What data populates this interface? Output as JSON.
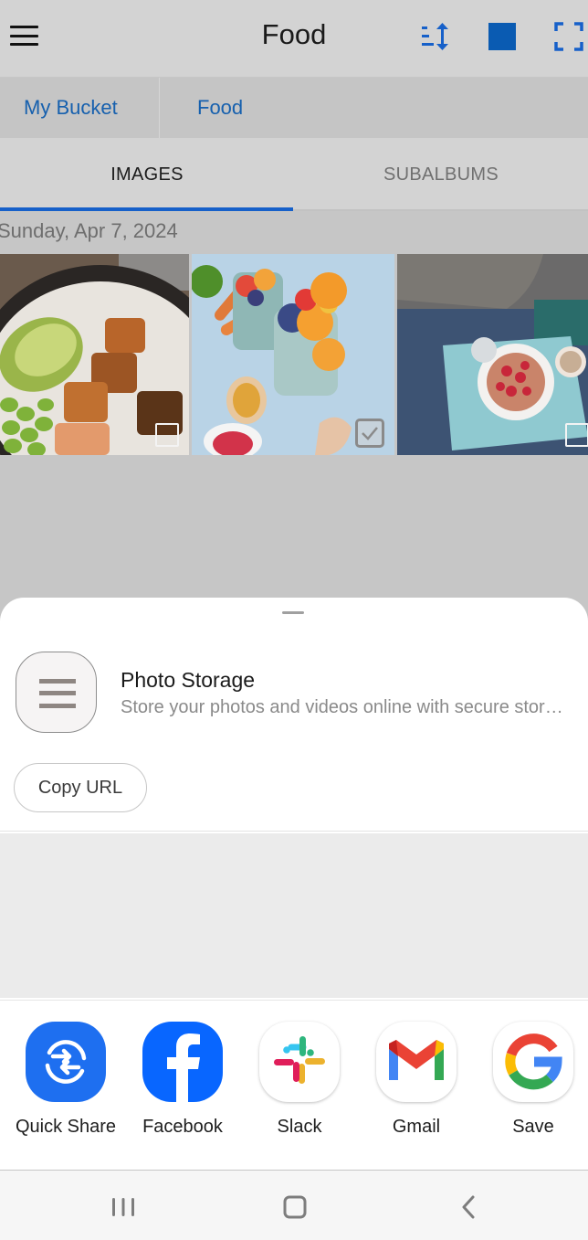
{
  "app": {
    "title": "Food",
    "toolbar": {
      "menu_icon": "hamburger-menu-icon",
      "sort_icon": "sort-order-icon",
      "select_icon": "select-all-square-icon",
      "fullscreen_icon": "fullscreen-icon"
    },
    "breadcrumb": [
      "My Bucket",
      "Food"
    ],
    "tabs": [
      {
        "label": "IMAGES",
        "active": true
      },
      {
        "label": "SUBALBUMS",
        "active": false
      }
    ],
    "date_header": "Sunday, Apr 7, 2024",
    "images": [
      {
        "subject": "poke bowl with avocado, salmon and edamame",
        "selected": false
      },
      {
        "subject": "smoothie glasses with fruit",
        "selected": true
      },
      {
        "subject": "breakfast tray with pancakes and strawberries",
        "selected": false
      }
    ]
  },
  "share_sheet": {
    "target_app": {
      "name": "Photo Storage",
      "description": "Store your photos and videos online with secure storage",
      "icon": "hamburger-menu-icon"
    },
    "copy_url_label": "Copy URL",
    "share_targets": [
      {
        "label": "Quick Share",
        "icon": "quick-share-icon"
      },
      {
        "label": "Facebook",
        "icon": "facebook-icon"
      },
      {
        "label": "Slack",
        "icon": "slack-icon"
      },
      {
        "label": "Gmail",
        "icon": "gmail-icon"
      },
      {
        "label": "Save",
        "icon": "google-icon"
      }
    ]
  },
  "navbar": {
    "buttons": [
      "recent-apps",
      "home",
      "back"
    ]
  },
  "colors": {
    "accent": "#1660c9",
    "link": "#1660ae",
    "scrim": "#c6c6c6",
    "sheet": "#ffffff"
  }
}
